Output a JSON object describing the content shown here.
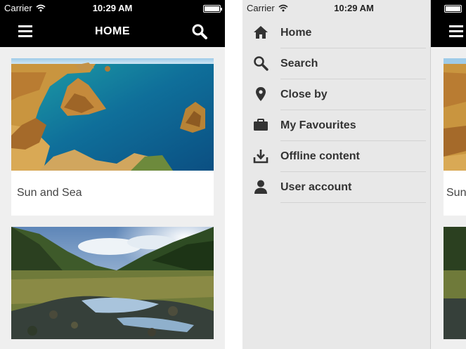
{
  "status_bar": {
    "carrier": "Carrier",
    "time": "10:29 AM"
  },
  "left_screen": {
    "title": "HOME",
    "cards": [
      {
        "caption": "Sun and Sea"
      },
      {
        "caption": ""
      }
    ]
  },
  "drawer": {
    "items": [
      {
        "label": "Home",
        "icon": "home-icon"
      },
      {
        "label": "Search",
        "icon": "search-icon"
      },
      {
        "label": "Close by",
        "icon": "location-pin-icon"
      },
      {
        "label": "My Favourites",
        "icon": "briefcase-icon"
      },
      {
        "label": "Offline content",
        "icon": "download-icon"
      },
      {
        "label": "User account",
        "icon": "user-icon"
      }
    ]
  },
  "peek": {
    "caption_fragment": "Sun"
  },
  "colors": {
    "navbar": "#000000",
    "background": "#efefef",
    "drawer": "#e8e8e8",
    "text": "#333333"
  }
}
